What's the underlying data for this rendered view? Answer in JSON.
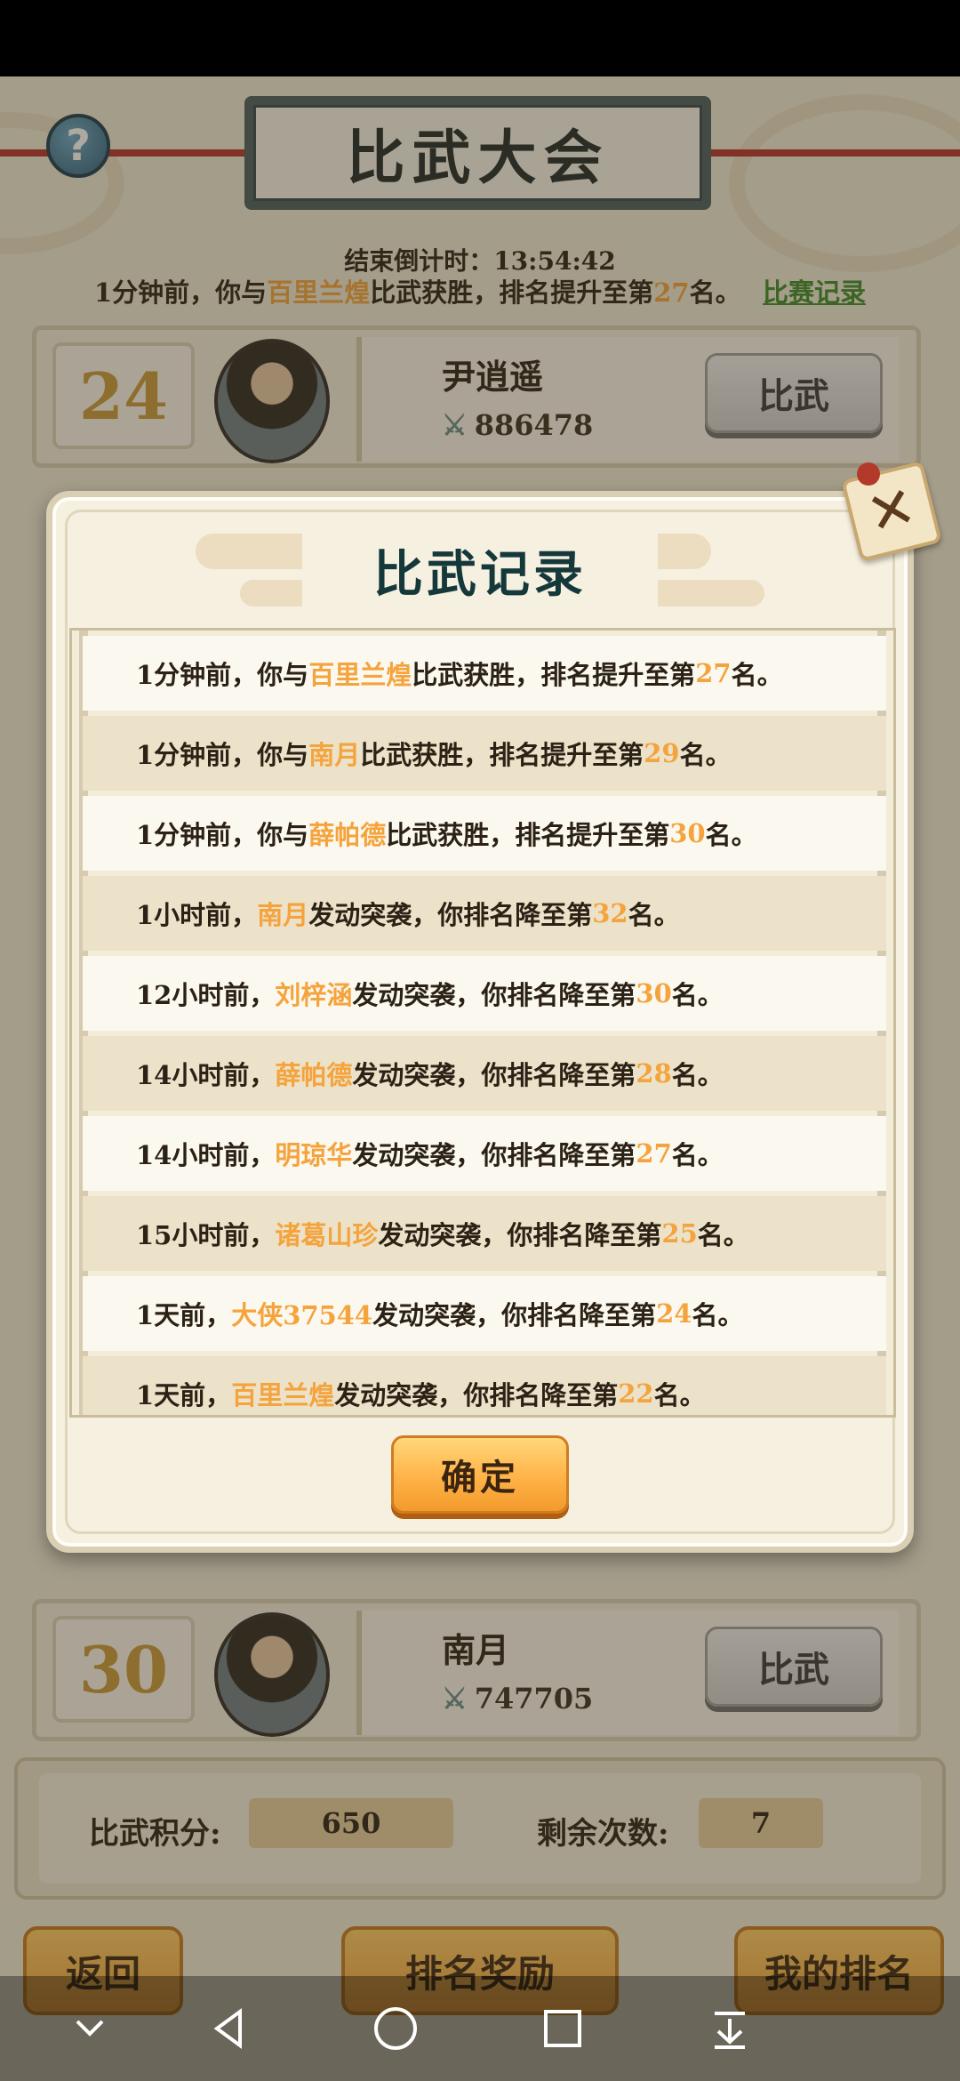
{
  "header": {
    "help_glyph": "?",
    "title": "比武大会",
    "countdown": "结束倒计时：13:54:42",
    "latest": {
      "prefix": "1分钟前，你与",
      "name": "百里兰煌",
      "middle": "比武获胜，排名提升至第",
      "rank": "27",
      "suffix": "名。"
    },
    "record_link": "比赛记录"
  },
  "opponents": [
    {
      "rank": "24",
      "name": "尹逍遥",
      "power": "886478",
      "fight_label": "比武"
    },
    {
      "rank": "30",
      "name": "南月",
      "power": "747705",
      "fight_label": "比武"
    }
  ],
  "stats": {
    "score_label": "比武积分:",
    "score_value": "650",
    "remaining_label": "剩余次数:",
    "remaining_value": "7"
  },
  "bottom_buttons": {
    "back": "返回",
    "rank_reward": "排名奖励",
    "my_rank": "我的排名"
  },
  "modal": {
    "title": "比武记录",
    "close_glyph": "✕",
    "confirm": "确定",
    "records": [
      {
        "pre": "1分钟前，你与",
        "name": "百里兰煌",
        "mid": "比武获胜，排名提升至第",
        "rank": "27",
        "post": "名。"
      },
      {
        "pre": "1分钟前，你与",
        "name": "南月",
        "mid": "比武获胜，排名提升至第",
        "rank": "29",
        "post": "名。"
      },
      {
        "pre": "1分钟前，你与",
        "name": "薛帕德",
        "mid": "比武获胜，排名提升至第",
        "rank": "30",
        "post": "名。"
      },
      {
        "pre": "1小时前，",
        "name": "南月",
        "mid": "发动突袭，你排名降至第",
        "rank": "32",
        "post": "名。"
      },
      {
        "pre": "12小时前，",
        "name": "刘梓涵",
        "mid": "发动突袭，你排名降至第",
        "rank": "30",
        "post": "名。"
      },
      {
        "pre": "14小时前，",
        "name": "薛帕德",
        "mid": "发动突袭，你排名降至第",
        "rank": "28",
        "post": "名。"
      },
      {
        "pre": "14小时前，",
        "name": "明琼华",
        "mid": "发动突袭，你排名降至第",
        "rank": "27",
        "post": "名。"
      },
      {
        "pre": "15小时前，",
        "name": "诸葛山珍",
        "mid": "发动突袭，你排名降至第",
        "rank": "25",
        "post": "名。"
      },
      {
        "pre": "1天前，",
        "name": "大侠37544",
        "mid": "发动突袭，你排名降至第",
        "rank": "24",
        "post": "名。"
      },
      {
        "pre": "1天前，",
        "name": "百里兰煌",
        "mid": "发动突袭，你排名降至第",
        "rank": "22",
        "post": "名。"
      }
    ]
  },
  "colors": {
    "highlight": "#f5a33c",
    "link": "#3d8a2a",
    "confirm": "#ffb347"
  }
}
